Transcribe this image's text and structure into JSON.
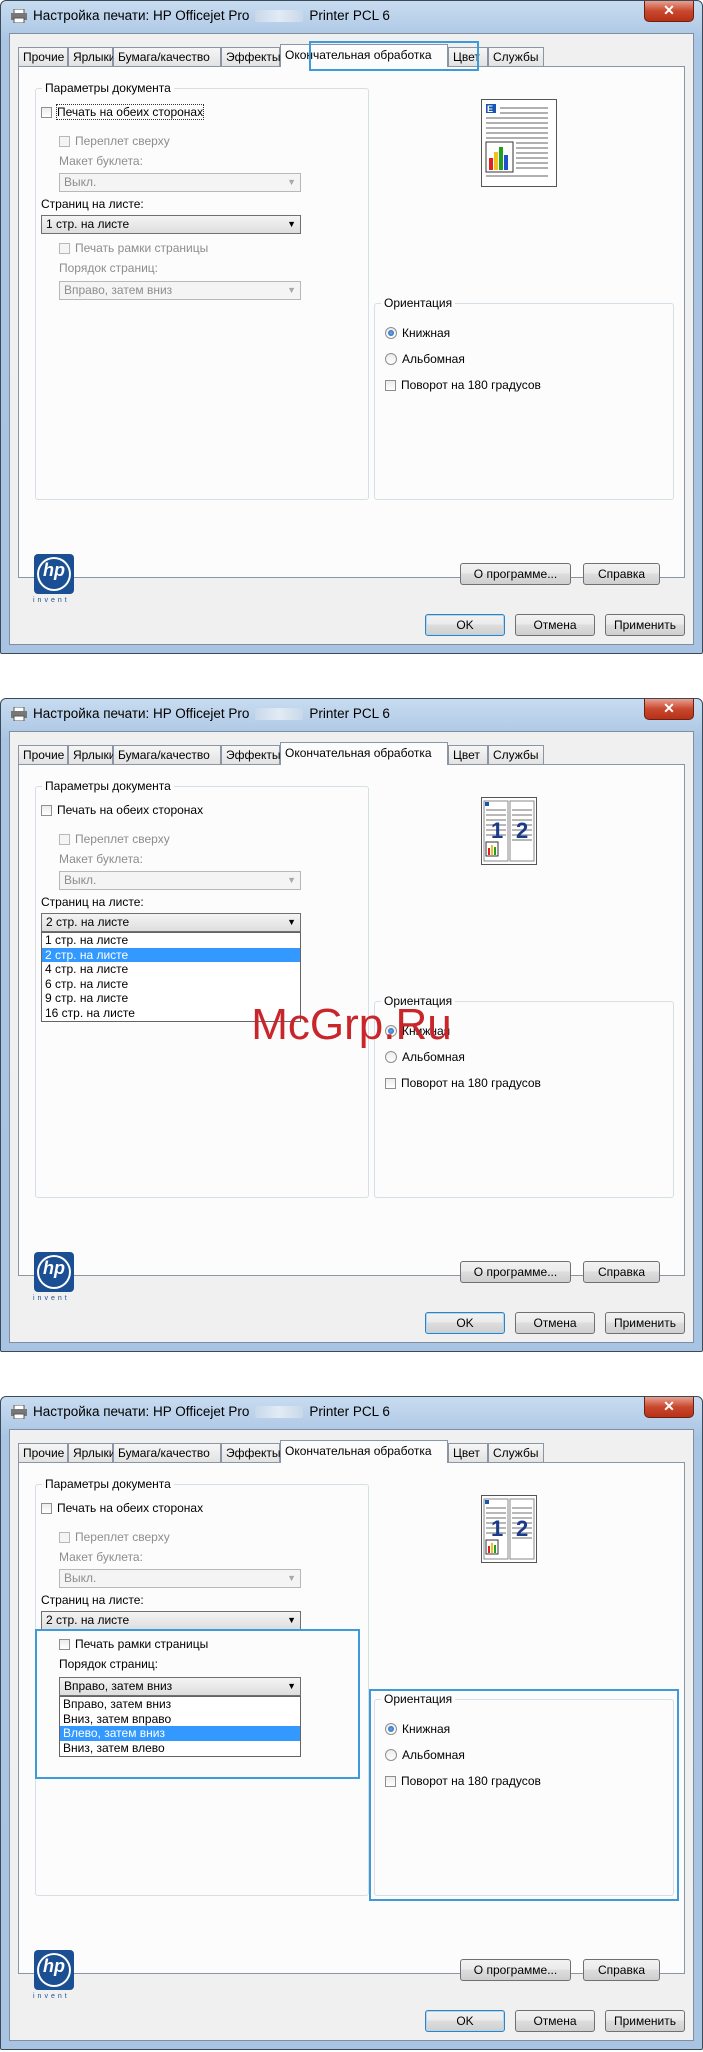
{
  "window": {
    "title_part1": "Настройка печати: HP Officejet Pro",
    "title_part2": "Printer PCL 6",
    "close_glyph": "✕"
  },
  "tabs": [
    "Прочие",
    "Ярлыки",
    "Бумага/качество",
    "Эффекты",
    "Окончательная обработка",
    "Цвет",
    "Службы"
  ],
  "active_tab": "Окончательная обработка",
  "doc_options": {
    "group_label": "Параметры документа",
    "duplex_label": "Печать на обеих сторонах",
    "flip_label": "Переплет сверху",
    "booklet_label": "Макет буклета:",
    "booklet_value": "Выкл.",
    "pages_per_sheet_label": "Страниц на листе:",
    "page_borders_label": "Печать рамки страницы",
    "page_order_label": "Порядок страниц:"
  },
  "orientation": {
    "group_label": "Ориентация",
    "portrait": "Книжная",
    "landscape": "Альбомная",
    "rotate": "Поворот на 180 градусов"
  },
  "buttons": {
    "about": "О программе...",
    "help": "Справка",
    "ok": "OK",
    "cancel": "Отмена",
    "apply": "Применить"
  },
  "logo": {
    "hp": "hp",
    "invent": "invent"
  },
  "preview_numbers": [
    "1",
    "2"
  ],
  "pages_per_sheet_options": [
    "1 стр. на листе",
    "2 стр. на листе",
    "4 стр. на листе",
    "6 стр. на листе",
    "9 стр. на листе",
    "16 стр. на листе"
  ],
  "page_order_options": [
    "Вправо, затем вниз",
    "Вниз, затем вправо",
    "Влево, затем вниз",
    "Вниз, затем влево"
  ],
  "screens": [
    {
      "pages_per_sheet": "1 стр. на листе",
      "page_order": "Вправо, затем вниз",
      "page_order_enabled": false,
      "dropdown_open": "none"
    },
    {
      "pages_per_sheet": "2 стр. на листе",
      "page_order": "Вправо, затем вниз",
      "page_order_enabled": false,
      "dropdown_open": "pages_per_sheet",
      "selected_option": "2 стр. на листе"
    },
    {
      "pages_per_sheet": "2 стр. на листе",
      "page_order": "Вправо, затем вниз",
      "page_order_enabled": true,
      "dropdown_open": "page_order",
      "selected_option": "Влево, затем вниз"
    }
  ],
  "watermark": "McGrp.Ru",
  "colors": {
    "highlight": "#3f9ad8",
    "selection": "#3399ff",
    "watermark": "#c8262b",
    "close": "#c8482e"
  }
}
